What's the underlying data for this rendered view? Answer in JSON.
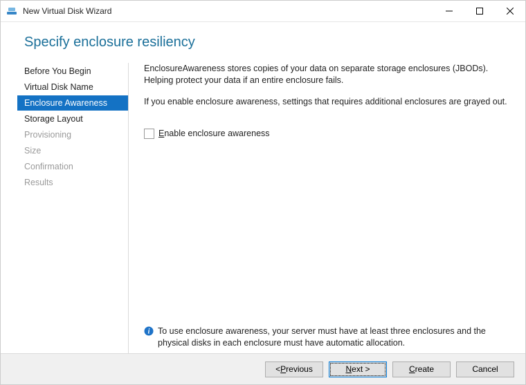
{
  "window": {
    "title": "New Virtual Disk Wizard"
  },
  "header": {
    "title": "Specify enclosure resiliency"
  },
  "sidebar": {
    "steps": [
      {
        "label": "Before You Begin",
        "state": "enabled"
      },
      {
        "label": "Virtual Disk Name",
        "state": "enabled"
      },
      {
        "label": "Enclosure Awareness",
        "state": "selected"
      },
      {
        "label": "Storage Layout",
        "state": "enabled"
      },
      {
        "label": "Provisioning",
        "state": "disabled"
      },
      {
        "label": "Size",
        "state": "disabled"
      },
      {
        "label": "Confirmation",
        "state": "disabled"
      },
      {
        "label": "Results",
        "state": "disabled"
      }
    ]
  },
  "pane": {
    "desc1": "EnclosureAwareness stores copies of your data on separate storage enclosures (JBODs). Helping protect your data if an entire enclosure fails.",
    "desc2": "If you enable enclosure awareness, settings that requires additional enclosures are grayed out.",
    "checkbox_access": "E",
    "checkbox_label_rest": "nable enclosure awareness",
    "note": "To use enclosure awareness, your server must have at least three enclosures and the physical disks in each enclosure must have automatic allocation."
  },
  "buttons": {
    "previous_pre": "< ",
    "previous_access": "P",
    "previous_rest": "revious",
    "next_access": "N",
    "next_rest": "ext >",
    "create_access": "C",
    "create_rest": "reate",
    "cancel": "Cancel"
  }
}
